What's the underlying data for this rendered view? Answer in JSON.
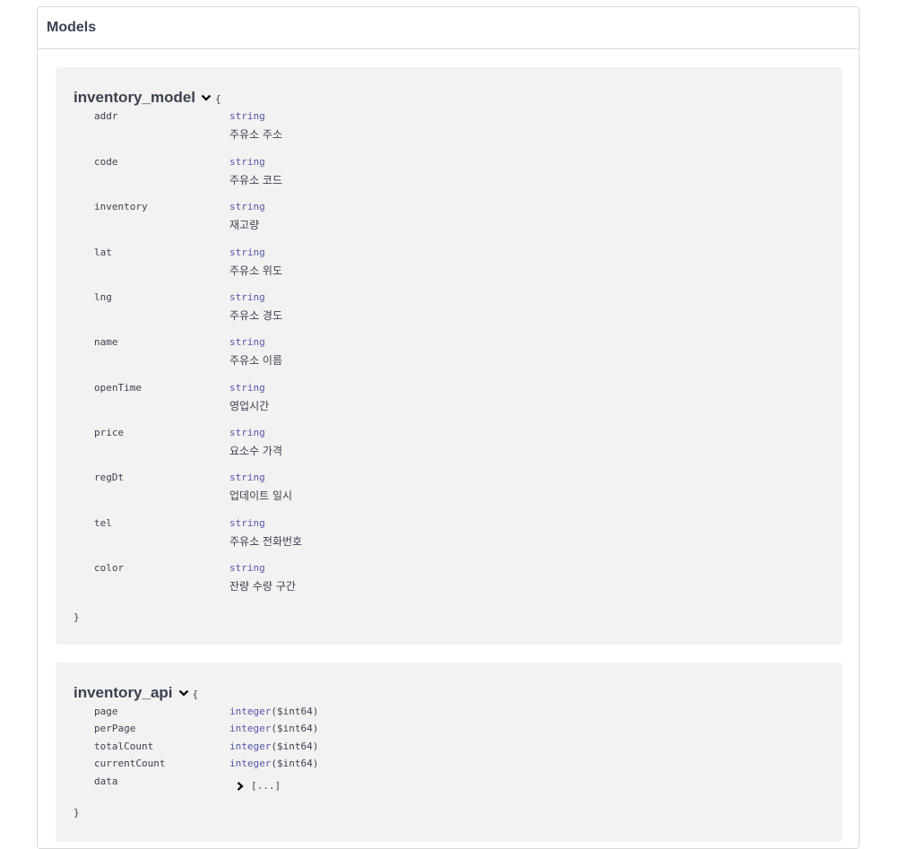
{
  "section": {
    "title": "Models"
  },
  "models": [
    {
      "name": "inventory_model",
      "open_brace": "{",
      "close_brace": "}",
      "properties": [
        {
          "name": "addr",
          "type": "string",
          "description": "주유소 주소"
        },
        {
          "name": "code",
          "type": "string",
          "description": "주유소 코드"
        },
        {
          "name": "inventory",
          "type": "string",
          "description": "재고량"
        },
        {
          "name": "lat",
          "type": "string",
          "description": "주유소 위도"
        },
        {
          "name": "lng",
          "type": "string",
          "description": "주유소 경도"
        },
        {
          "name": "name",
          "type": "string",
          "description": "주유소 이름"
        },
        {
          "name": "openTime",
          "type": "string",
          "description": "영업시간"
        },
        {
          "name": "price",
          "type": "string",
          "description": "요소수 가격"
        },
        {
          "name": "regDt",
          "type": "string",
          "description": "업데이트 일시"
        },
        {
          "name": "tel",
          "type": "string",
          "description": "주유소 전화번호"
        },
        {
          "name": "color",
          "type": "string",
          "description": "잔량 수량 구간"
        }
      ]
    },
    {
      "name": "inventory_api",
      "open_brace": "{",
      "close_brace": "}",
      "properties": [
        {
          "name": "page",
          "type": "integer",
          "format": "($int64)"
        },
        {
          "name": "perPage",
          "type": "integer",
          "format": "($int64)"
        },
        {
          "name": "totalCount",
          "type": "integer",
          "format": "($int64)"
        },
        {
          "name": "currentCount",
          "type": "integer",
          "format": "($int64)"
        },
        {
          "name": "data",
          "collapsed_value": "[...]"
        }
      ]
    }
  ]
}
